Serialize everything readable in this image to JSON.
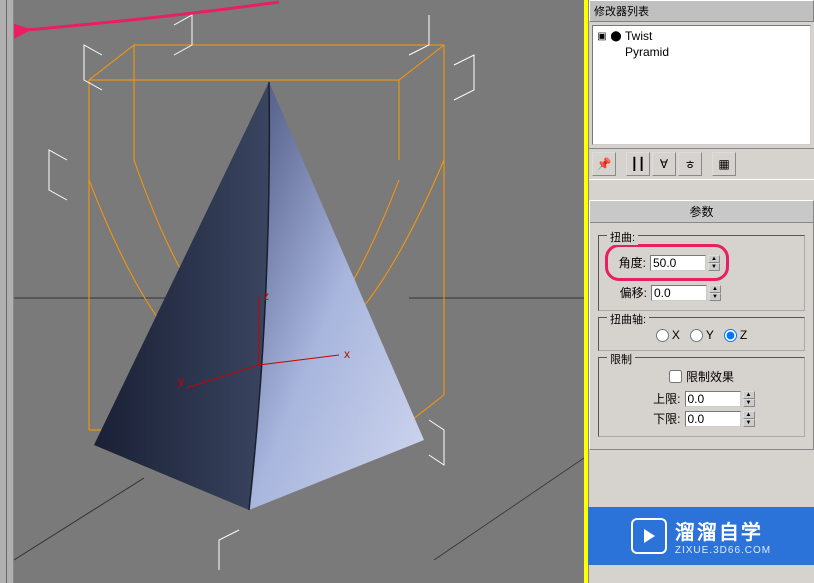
{
  "modifier_stack": {
    "header": "修改器列表",
    "items": [
      {
        "icon": "＋",
        "plug": "⬤",
        "label": "Twist"
      },
      {
        "icon": "",
        "plug": "",
        "label": "Pyramid"
      }
    ]
  },
  "params": {
    "title": "参数",
    "twist": {
      "group": "扭曲:",
      "angle_label": "角度:",
      "angle_value": "50.0",
      "bias_label": "偏移:",
      "bias_value": "0.0"
    },
    "axis": {
      "group": "扭曲轴:",
      "x": "X",
      "y": "Y",
      "z": "Z",
      "selected": "Z"
    },
    "limit": {
      "group": "限制",
      "effect_label": "限制效果",
      "upper_label": "上限:",
      "upper_value": "0.0",
      "lower_label": "下限:",
      "lower_value": "0.0"
    }
  },
  "viewport": {
    "axes": {
      "x": "x",
      "y": "y",
      "z": "z"
    }
  },
  "watermark": {
    "main": "溜溜自学",
    "sub": "ZIXUE.3D66.COM"
  }
}
